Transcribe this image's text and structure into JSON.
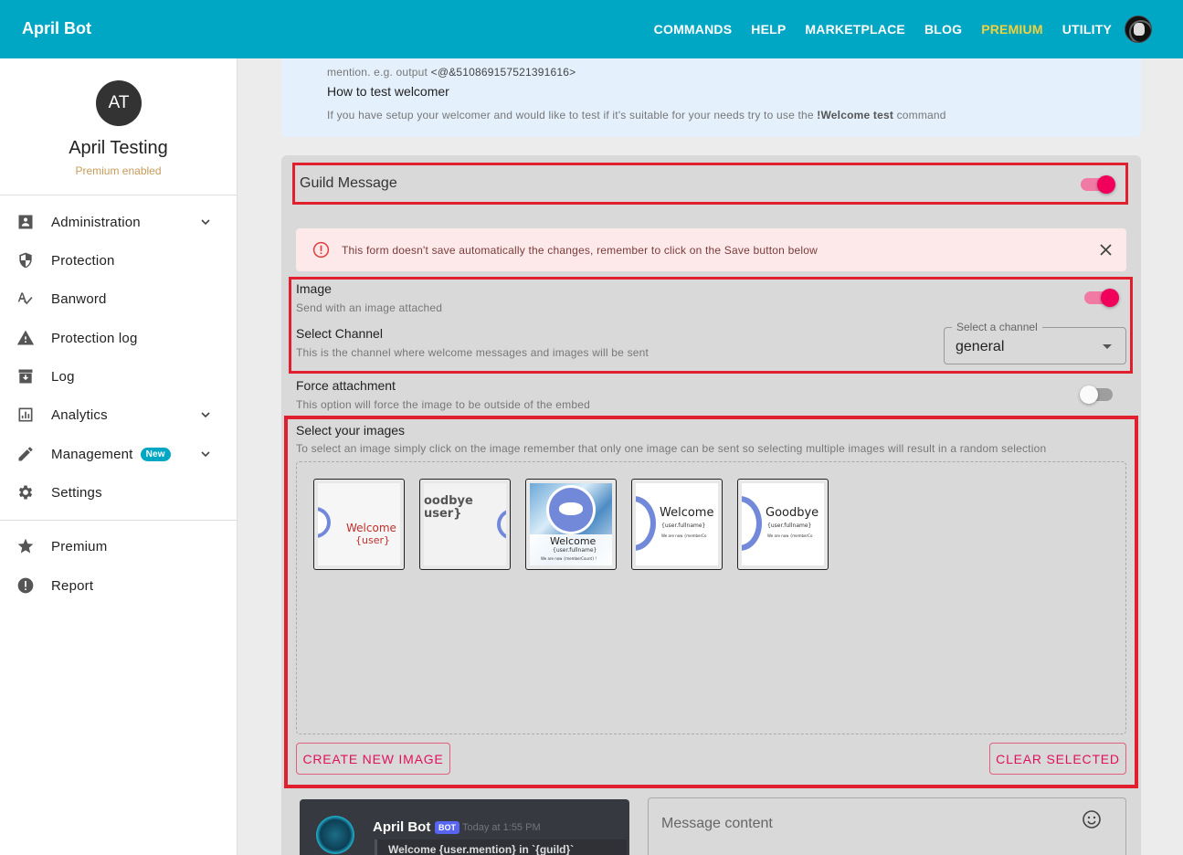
{
  "app": {
    "brand": "April Bot"
  },
  "nav": {
    "items": [
      "COMMANDS",
      "HELP",
      "MARKETPLACE",
      "BLOG",
      "PREMIUM",
      "UTILITY"
    ]
  },
  "profile": {
    "initials": "AT",
    "name": "April Testing",
    "status": "Premium enabled"
  },
  "sidebar": {
    "items": [
      {
        "label": "Administration",
        "icon": "badge-icon",
        "expandable": true
      },
      {
        "label": "Protection",
        "icon": "shield-icon",
        "expandable": false
      },
      {
        "label": "Banword",
        "icon": "spellcheck-icon",
        "expandable": false
      },
      {
        "label": "Protection log",
        "icon": "warning-icon",
        "expandable": false
      },
      {
        "label": "Log",
        "icon": "archive-icon",
        "expandable": false
      },
      {
        "label": "Analytics",
        "icon": "chart-icon",
        "expandable": true
      },
      {
        "label": "Management",
        "icon": "pencil-icon",
        "expandable": true,
        "badge": "New"
      },
      {
        "label": "Settings",
        "icon": "gear-icon",
        "expandable": false
      }
    ],
    "secondary": [
      {
        "label": "Premium",
        "icon": "star-icon"
      },
      {
        "label": "Report",
        "icon": "report-icon"
      }
    ]
  },
  "info": {
    "mention_prefix": "mention. e.g. output ",
    "mention_value": "<@&510869157521391616>",
    "test_title": "How to test welcomer",
    "test_text_before": "If you have setup your welcomer and would like to test if it's suitable for your needs try to use the ",
    "test_command": "!Welcome test",
    "test_text_after": " command"
  },
  "guild": {
    "title": "Guild Message",
    "enabled": true
  },
  "alert": {
    "text": "This form doesn't save automatically the changes, remember to click on the Save button below"
  },
  "image_section": {
    "label": "Image",
    "description": "Send with an image attached",
    "enabled": true
  },
  "channel_section": {
    "label": "Select Channel",
    "description": "This is the channel where welcome messages and images will be sent",
    "select_legend": "Select a channel",
    "select_value": "general"
  },
  "force_section": {
    "label": "Force attachment",
    "description": "This option will force the image to be outside of the embed",
    "enabled": false
  },
  "images_section": {
    "label": "Select your images",
    "description": "To select an image simply click on the image remember that only one image can be sent so selecting multiple images will result in a random selection",
    "thumbs": [
      {
        "line1": "Welcome",
        "line2": "{user}",
        "color": "#c0302a"
      },
      {
        "line1": "oodbye",
        "line2": "user}",
        "color": "#555555"
      },
      {
        "line1": "Welcome",
        "line2": "{user.fullname}",
        "line3": "We are now {memberCount} !"
      },
      {
        "line1": "Welcome",
        "line2": "{user.fullname}",
        "line3": "We are now {memberCo"
      },
      {
        "line1": "Goodbye",
        "line2": "{user.fullname}",
        "line3": "We are now {memberCo"
      }
    ],
    "create_button": "CREATE NEW IMAGE",
    "clear_button": "CLEAR SELECTED"
  },
  "preview": {
    "bot_name": "April Bot",
    "bot_tag": "BOT",
    "timestamp": "Today at 1:55 PM",
    "message": "Welcome {user.mention} in `{guild}`"
  },
  "message_field": {
    "placeholder": "Message content"
  },
  "colors": {
    "topbar": "#00a7c4",
    "accent": "#f0005a",
    "premium": "#f2d23c",
    "highlight": "#e0202e"
  }
}
